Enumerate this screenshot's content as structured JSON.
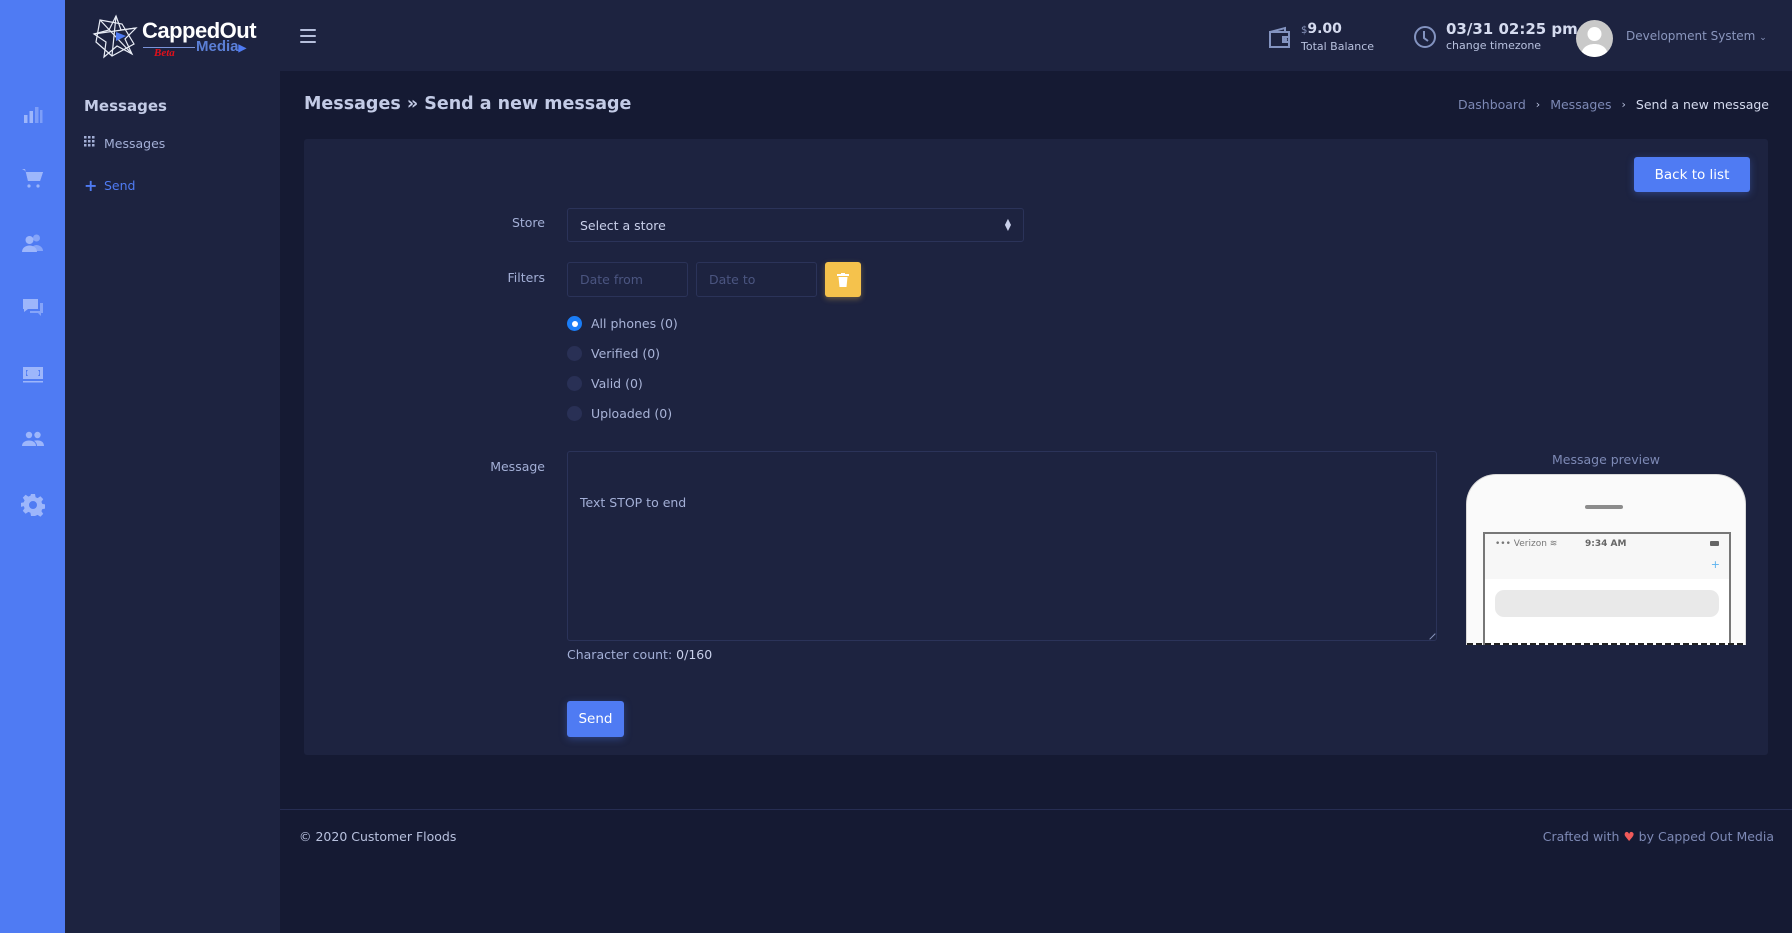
{
  "brand": {
    "name_top": "CappedOut",
    "name_bottom": "Media",
    "tag": "Beta"
  },
  "rail": {
    "icons": [
      "bar-chart-icon",
      "shopping-cart-icon",
      "customers-icon",
      "chat-icon",
      "money-icon",
      "users-icon",
      "gear-icon"
    ]
  },
  "header": {
    "balance_currency": "$",
    "balance_value": "9.00",
    "balance_label": "Total Balance",
    "datetime": "03/31 02:25 pm",
    "timezone_link": "change timezone",
    "user_name": "Development System"
  },
  "sidebar": {
    "title": "Messages",
    "items": [
      {
        "label": "Messages",
        "icon": "grid-icon",
        "active": false
      },
      {
        "label": "Send",
        "icon": "plus-icon",
        "active": true
      }
    ]
  },
  "page": {
    "title": "Messages » Send a new message",
    "breadcrumb": [
      "Dashboard",
      "Messages",
      "Send a new message"
    ],
    "back_button": "Back to list"
  },
  "form": {
    "store_label": "Store",
    "store_value": "Select a store",
    "filters_label": "Filters",
    "date_from_placeholder": "Date from",
    "date_to_placeholder": "Date to",
    "radios": [
      {
        "label": "All phones (0)",
        "checked": true
      },
      {
        "label": "Verified (0)",
        "checked": false
      },
      {
        "label": "Valid (0)",
        "checked": false
      },
      {
        "label": "Uploaded (0)",
        "checked": false
      }
    ],
    "message_label": "Message",
    "message_value": "Text STOP to end",
    "char_count_label": "Character count:",
    "char_count_value": "0/160",
    "send_button": "Send"
  },
  "preview": {
    "label": "Message preview",
    "carrier": "••• Verizon",
    "time": "9:34 AM"
  },
  "footer": {
    "copyright": "© 2020 Customer Floods",
    "crafted_prefix": "Crafted with",
    "crafted_suffix": "by Capped Out Media"
  },
  "colors": {
    "accent": "#4f7bf3",
    "warning": "#f5c24c",
    "radio_active": "#1a7df7",
    "heart": "#f05a5a"
  }
}
